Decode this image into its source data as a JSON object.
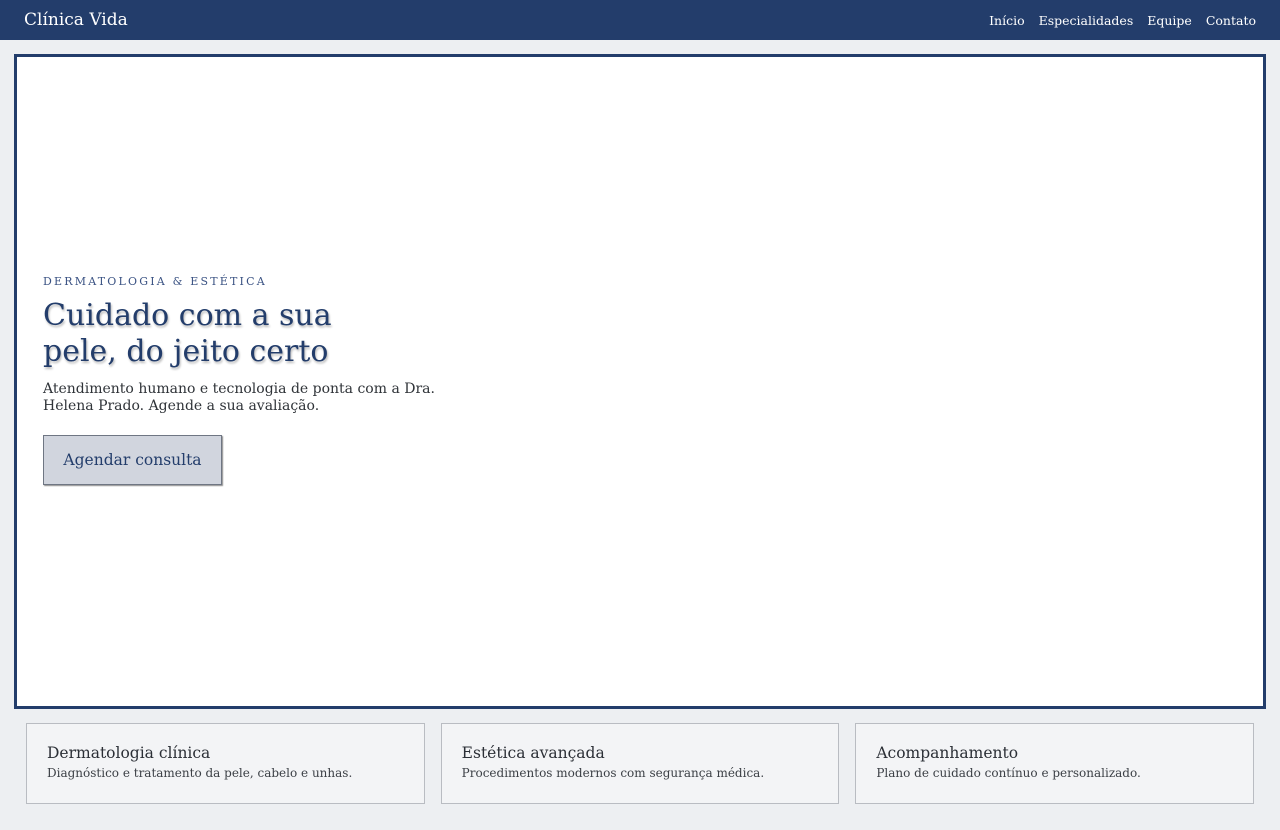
{
  "header": {
    "brand": "Clínica Vida",
    "nav": [
      {
        "label": "Início"
      },
      {
        "label": "Especialidades"
      },
      {
        "label": "Equipe"
      },
      {
        "label": "Contato"
      }
    ]
  },
  "hero": {
    "eyebrow": "DERMATOLOGIA & ESTÉTICA",
    "headline": "Cuidado com a sua pele, do jeito certo",
    "lead": "Atendimento humano e tecnologia de ponta com a Dra. Helena Prado. Agende a sua avaliação.",
    "cta_label": "Agendar consulta"
  },
  "services": [
    {
      "title": "Dermatologia clínica",
      "desc": "Diagnóstico e tratamento da pele, cabelo e unhas."
    },
    {
      "title": "Estética avançada",
      "desc": "Procedimentos modernos com segurança médica."
    },
    {
      "title": "Acompanhamento",
      "desc": "Plano de cuidado contínuo e personalizado."
    }
  ],
  "colors": {
    "primary": "#233d6b",
    "background": "#edeff2",
    "card_background": "#f3f4f6",
    "cta_background": "#d1d5de"
  }
}
